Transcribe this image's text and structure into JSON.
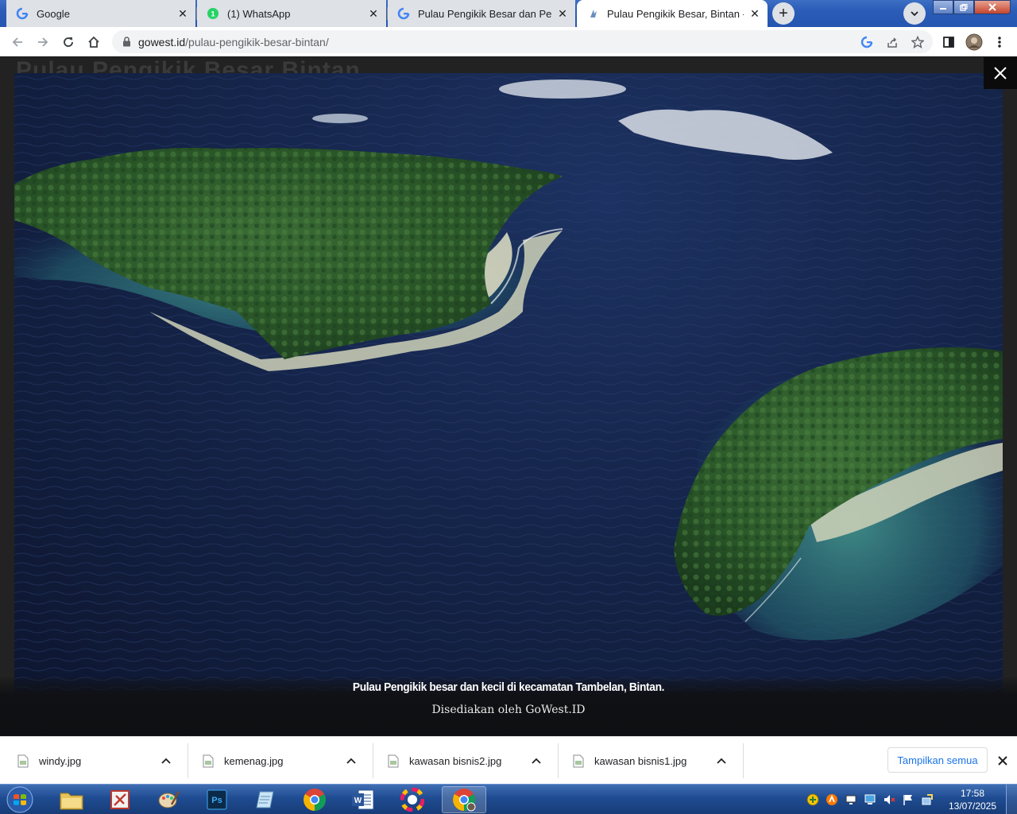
{
  "browser": {
    "tabs": [
      {
        "title": "Google",
        "icon": "google-icon",
        "active": false
      },
      {
        "title": "(1) WhatsApp",
        "icon": "whatsapp-icon",
        "active": false
      },
      {
        "title": "Pulau Pengikik Besar dan Pengkik",
        "icon": "google-icon",
        "active": false
      },
      {
        "title": "Pulau Pengikik Besar, Bintan - Go",
        "icon": "gowest-icon",
        "active": true
      }
    ],
    "new_tab_label": "+",
    "url_host": "gowest.id",
    "url_path": "/pulau-pengikik-besar-bintan/"
  },
  "page": {
    "behind_title": "Pulau Pengikik Besar Bintan"
  },
  "lightbox": {
    "caption": "Pulau Pengikik besar dan kecil di kecamatan Tambelan, Bintan.",
    "credit": "Disediakan oleh GoWest.ID",
    "close_icon": "close-icon"
  },
  "downloads": {
    "items": [
      {
        "name": "windy.jpg"
      },
      {
        "name": "kemenag.jpg"
      },
      {
        "name": "kawasan bisnis2.jpg"
      },
      {
        "name": "kawasan bisnis1.jpg"
      }
    ],
    "show_all": "Tampilkan semua"
  },
  "taskbar": {
    "time": "17:58",
    "date": "13/07/2025"
  },
  "colors": {
    "sea": "#14244a",
    "island": "#2c5a2c",
    "link": "#1a73e8",
    "taskbar": "#1f4c91"
  }
}
